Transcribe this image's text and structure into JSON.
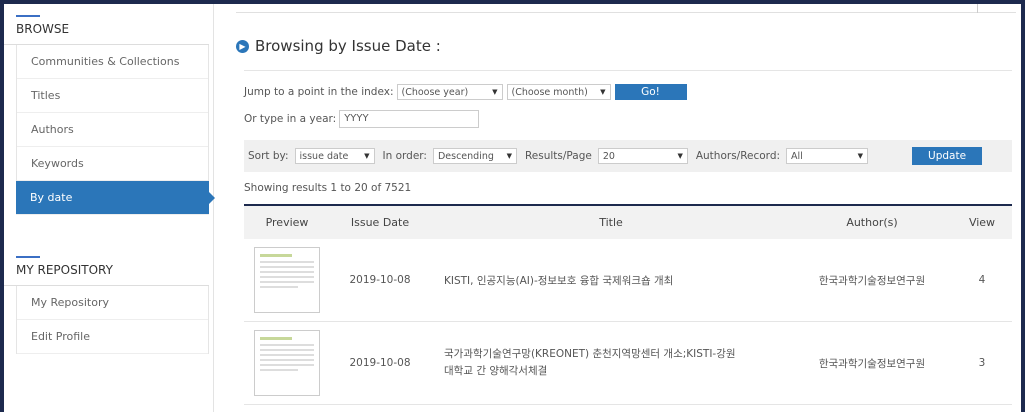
{
  "sidebar": {
    "browse_heading": "BROWSE",
    "browse_items": [
      {
        "label": "Communities & Collections"
      },
      {
        "label": "Titles"
      },
      {
        "label": "Authors"
      },
      {
        "label": "Keywords"
      },
      {
        "label": "By date"
      }
    ],
    "active_item": "By date",
    "repo_heading": "MY REPOSITORY",
    "repo_items": [
      {
        "label": "My Repository"
      },
      {
        "label": "Edit Profile"
      }
    ]
  },
  "main": {
    "title": "Browsing by Issue Date :",
    "jump": {
      "label": "Jump to a point in the index:",
      "year_select": "(Choose year)",
      "month_select": "(Choose month)",
      "go_label": "Go!",
      "type_label": "Or type in a year:",
      "year_placeholder": "YYYY"
    },
    "sort": {
      "sort_by_label": "Sort by:",
      "sort_by_value": "issue date",
      "order_label": "In order:",
      "order_value": "Descending",
      "results_label": "Results/Page",
      "results_value": "20",
      "authors_label": "Authors/Record:",
      "authors_value": "All",
      "update_label": "Update"
    },
    "showing": "Showing results 1 to 20 of 7521",
    "table": {
      "headers": {
        "preview": "Preview",
        "date": "Issue Date",
        "title": "Title",
        "author": "Author(s)",
        "view": "View"
      },
      "rows": [
        {
          "date": "2019-10-08",
          "title_line1": "KISTI, 인공지능(AI)-정보보호 융합 국제워크숍 개최",
          "title_line2": "",
          "author": "한국과학기술정보연구원",
          "view": "4"
        },
        {
          "date": "2019-10-08",
          "title_line1": "국가과학기술연구망(KREONET) 춘천지역망센터 개소;KISTI-강원",
          "title_line2": "대학교 간 양해각서체결",
          "author": "한국과학기술정보연구원",
          "view": "3"
        }
      ]
    }
  },
  "colors": {
    "accent": "#2b76b9",
    "frame": "#1d2a4e"
  }
}
